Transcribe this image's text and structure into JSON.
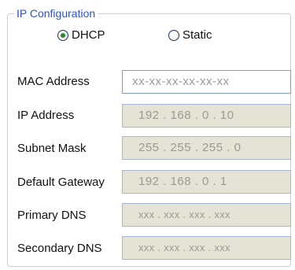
{
  "group": {
    "title": "IP Configuration"
  },
  "mode": {
    "options": [
      "DHCP",
      "Static"
    ],
    "selected": "DHCP"
  },
  "fields": [
    {
      "label": "MAC Address",
      "value": "xx-xx-xx-xx-xx-xx"
    },
    {
      "label": "IP Address",
      "value": "192 . 168 . 0 . 10"
    },
    {
      "label": "Subnet Mask",
      "value": "255 . 255 . 255 . 0"
    },
    {
      "label": "Default Gateway",
      "value": "192 . 168 . 0 . 1"
    },
    {
      "label": "Primary DNS",
      "value": "xxx . xxx . xxx . xxx"
    },
    {
      "label": "Secondary DNS",
      "value": "xxx . xxx . xxx . xxx"
    }
  ]
}
